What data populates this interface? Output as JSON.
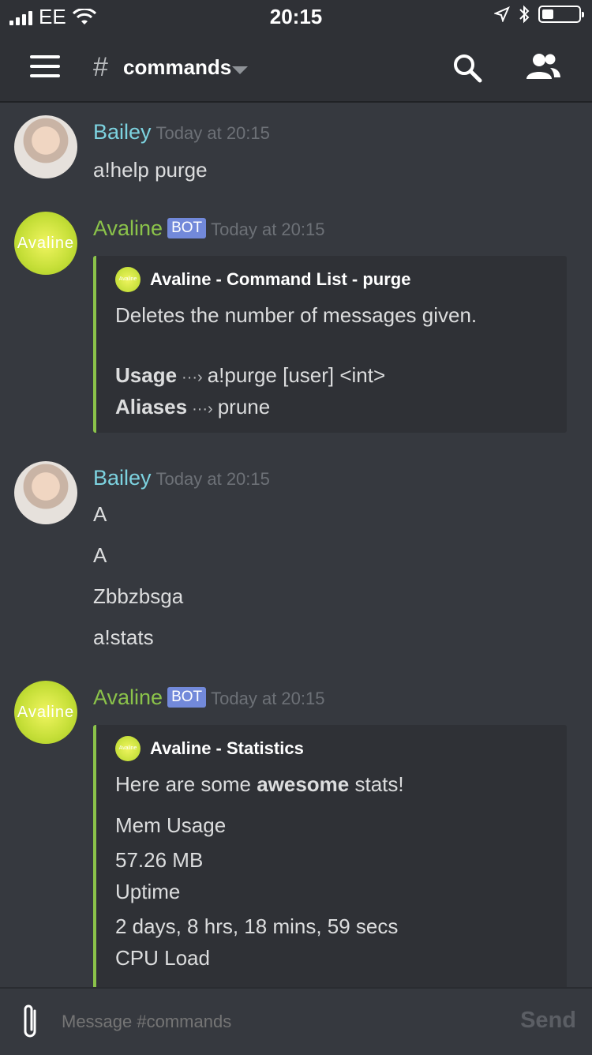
{
  "status_bar": {
    "carrier": "EE",
    "time": "20:15"
  },
  "header": {
    "hash": "#",
    "channel_name": "commands",
    "icons": [
      "menu-icon",
      "search-icon",
      "members-icon"
    ]
  },
  "messages": [
    {
      "author": "Bailey",
      "timestamp": "Today at 20:15",
      "lines": [
        "a!help purge"
      ]
    },
    {
      "author": "Avaline",
      "bot_badge": "BOT",
      "timestamp": "Today at 20:15",
      "avatar_text": "Avaline",
      "embed": {
        "author": "Avaline - Command List - purge",
        "author_icon_text": "Avaline",
        "description": "Deletes the number of messages given.",
        "usage_label": "Usage",
        "arrow": "···›",
        "usage_value": "a!purge [user] <int>",
        "aliases_label": "Aliases",
        "aliases_value": "prune"
      }
    },
    {
      "author": "Bailey",
      "timestamp": "Today at 20:15",
      "lines": [
        "A",
        "A",
        "Zbbzbsga",
        "a!stats"
      ]
    },
    {
      "author": "Avaline",
      "bot_badge": "BOT",
      "timestamp": "Today at 20:15",
      "avatar_text": "Avaline",
      "embed": {
        "author": "Avaline - Statistics",
        "author_icon_text": "Avaline",
        "description_prefix": "Here are some ",
        "description_bold": "awesome",
        "description_suffix": " stats!",
        "fields": [
          {
            "name": "Mem Usage",
            "value": "57.26 MB"
          },
          {
            "name": "Uptime",
            "value": "2 days, 8 hrs, 18 mins, 59 secs"
          },
          {
            "name": "CPU Load",
            "value": ""
          }
        ]
      }
    }
  ],
  "input": {
    "placeholder": "Message #commands",
    "send_label": "Send"
  },
  "colors": {
    "background": "#36393f",
    "header": "#2f3136",
    "bailey": "#7dd3e0",
    "avaline": "#8bc34a",
    "bot_badge": "#7289da",
    "embed_border": "#8bc34a"
  }
}
